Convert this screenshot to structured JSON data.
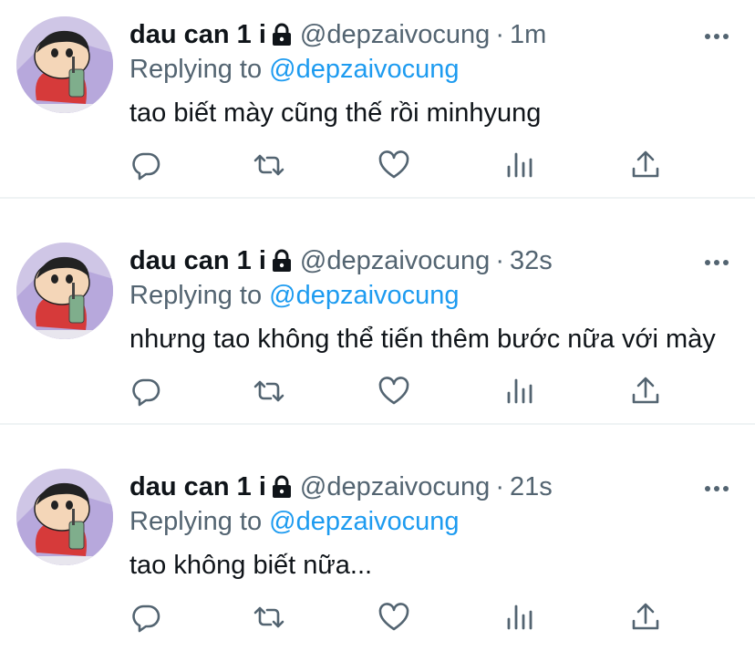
{
  "tweets": [
    {
      "name": "dau can 1 i",
      "handle": "@depzaivocung",
      "separator": "·",
      "time": "1m",
      "replying_prefix": "Replying to",
      "replying_to": "@depzaivocung",
      "text": "tao biết mày cũng thế rồi minhyung"
    },
    {
      "name": "dau can 1 i",
      "handle": "@depzaivocung",
      "separator": "·",
      "time": "32s",
      "replying_prefix": "Replying to",
      "replying_to": "@depzaivocung",
      "text": "nhưng tao không thể tiến thêm bước nữa với mày"
    },
    {
      "name": "dau can 1 i",
      "handle": "@depzaivocung",
      "separator": "·",
      "time": "21s",
      "replying_prefix": "Replying to",
      "replying_to": "@depzaivocung",
      "text": "tao không biết nữa..."
    }
  ],
  "icons": {
    "lock": "lock-icon",
    "more": "more-icon",
    "reply": "reply-icon",
    "retweet": "retweet-icon",
    "like": "like-icon",
    "analytics": "analytics-icon",
    "share": "share-icon"
  },
  "colors": {
    "text": "#0f1419",
    "secondary": "#536471",
    "accent": "#1d9bf0",
    "divider": "#eff3f4"
  }
}
